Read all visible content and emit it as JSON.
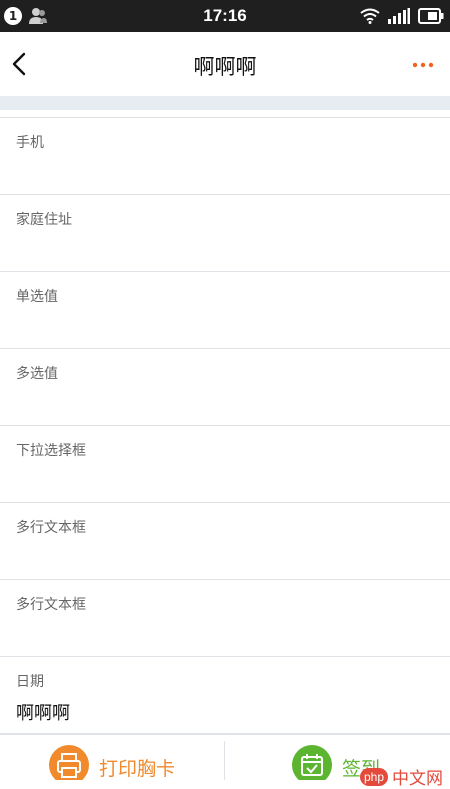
{
  "status_bar": {
    "notification_count": "1",
    "time": "17:16"
  },
  "nav": {
    "title": "啊啊啊"
  },
  "fields": [
    {
      "label": "手机",
      "value": ""
    },
    {
      "label": "家庭住址",
      "value": ""
    },
    {
      "label": "单选值",
      "value": ""
    },
    {
      "label": "多选值",
      "value": ""
    },
    {
      "label": "下拉选择框",
      "value": ""
    },
    {
      "label": "多行文本框",
      "value": ""
    },
    {
      "label": "多行文本框",
      "value": ""
    },
    {
      "label": "日期",
      "value": "啊啊啊"
    }
  ],
  "bottom_bar": {
    "print_label": "打印胸卡",
    "signin_label": "签到"
  },
  "watermark": {
    "badge": "php",
    "text": "中文网"
  },
  "colors": {
    "accent_orange": "#f08a2c",
    "more_orange": "#f26322",
    "signin_green": "#5cb531"
  }
}
